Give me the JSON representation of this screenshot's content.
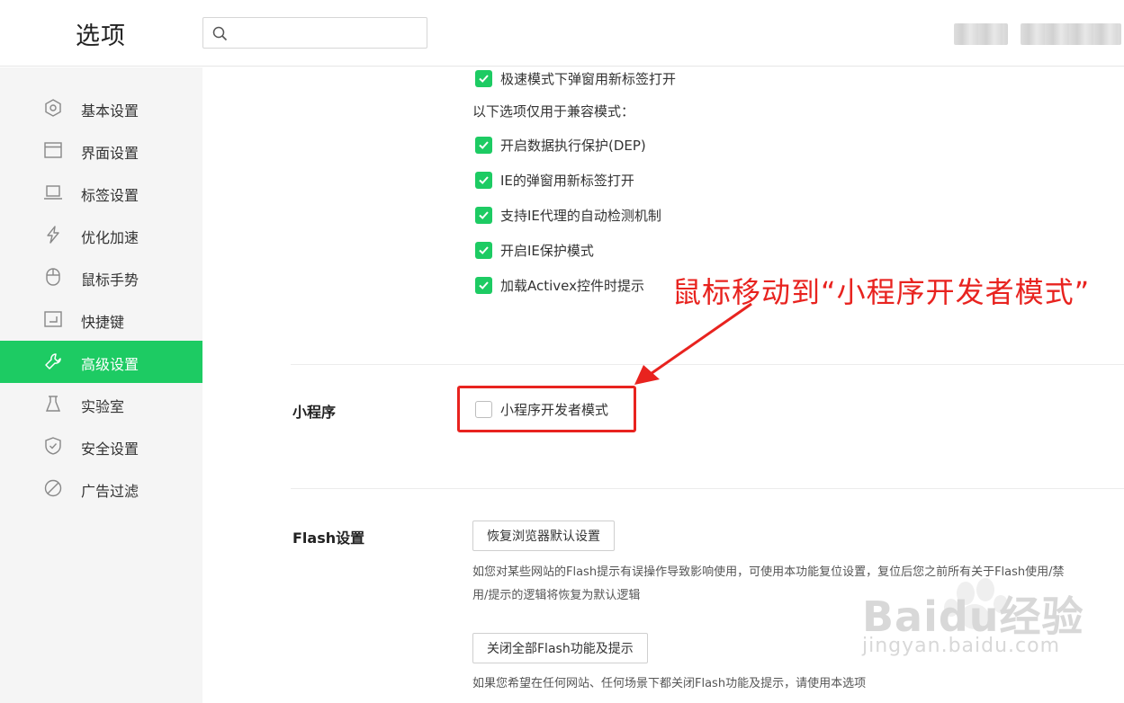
{
  "header": {
    "title": "选项",
    "search_placeholder": ""
  },
  "sidebar": {
    "items": [
      {
        "label": "基本设置",
        "icon": "hexagon-settings-icon"
      },
      {
        "label": "界面设置",
        "icon": "window-icon"
      },
      {
        "label": "标签设置",
        "icon": "laptop-icon"
      },
      {
        "label": "优化加速",
        "icon": "lightning-icon"
      },
      {
        "label": "鼠标手势",
        "icon": "mouse-icon"
      },
      {
        "label": "快捷键",
        "icon": "keyboard-enter-icon"
      },
      {
        "label": "高级设置",
        "icon": "wrench-icon"
      },
      {
        "label": "实验室",
        "icon": "flask-icon"
      },
      {
        "label": "安全设置",
        "icon": "shield-icon"
      },
      {
        "label": "广告过滤",
        "icon": "block-icon"
      }
    ],
    "active_index": 6
  },
  "main": {
    "checkboxes_top": [
      {
        "label": "极速模式下弹窗用新标签打开",
        "checked": true
      }
    ],
    "compat_note": "以下选项仅用于兼容模式：",
    "checkboxes_compat": [
      {
        "label": "开启数据执行保护(DEP)",
        "checked": true
      },
      {
        "label": "IE的弹窗用新标签打开",
        "checked": true
      },
      {
        "label": "支持IE代理的自动检测机制",
        "checked": true
      },
      {
        "label": "开启IE保护模式",
        "checked": true
      },
      {
        "label": "加载Activex控件时提示",
        "checked": true
      }
    ],
    "miniprogram": {
      "title": "小程序",
      "checkbox_label": "小程序开发者模式",
      "checked": false
    },
    "flash": {
      "title": "Flash设置",
      "reset_button": "恢复浏览器默认设置",
      "reset_desc": "如您对某些网站的Flash提示有误操作导致影响使用，可使用本功能复位设置，复位后您之前所有关于Flash使用/禁用/提示的逻辑将恢复为默认逻辑",
      "disable_button": "关闭全部Flash功能及提示",
      "disable_desc": "如果您希望在任何网站、任何场景下都关闭Flash功能及提示，请使用本选项"
    }
  },
  "annotation": {
    "text": "鼠标移动到“小程序开发者模式”",
    "color": "#e8231f"
  },
  "watermark": {
    "text": "Baidu经验",
    "url": "jingyan.baidu.com"
  },
  "colors": {
    "accent": "#1dcb63",
    "annotation_red": "#e8231f"
  }
}
